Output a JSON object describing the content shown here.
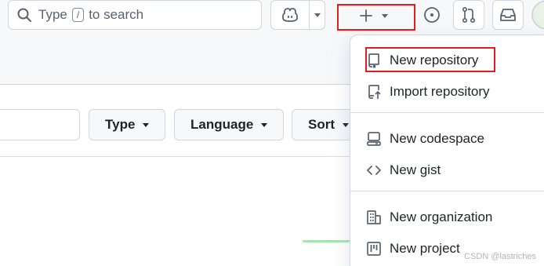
{
  "header": {
    "search": {
      "prefix": "Type",
      "kbd": "/",
      "suffix": "to search"
    },
    "icons": {
      "copilot": "copilot-icon",
      "create": "plus-icon",
      "issues": "issue-opened-icon",
      "pull_requests": "git-pull-request-icon",
      "inbox": "inbox-icon"
    }
  },
  "filters": {
    "type_label": "Type",
    "language_label": "Language",
    "sort_label": "Sort"
  },
  "create_menu": {
    "items": [
      {
        "label": "New repository",
        "icon": "repo-icon"
      },
      {
        "label": "Import repository",
        "icon": "repo-push-icon"
      },
      {
        "label": "New codespace",
        "icon": "codespaces-icon"
      },
      {
        "label": "New gist",
        "icon": "code-icon"
      },
      {
        "label": "New organization",
        "icon": "organization-icon"
      },
      {
        "label": "New project",
        "icon": "project-icon"
      }
    ]
  },
  "watermark": "CSDN @lastriches",
  "colors": {
    "highlight_box": "#e01e1e",
    "border": "#d0d7de",
    "header_bg": "#f6f8fa",
    "text": "#1f2328"
  }
}
